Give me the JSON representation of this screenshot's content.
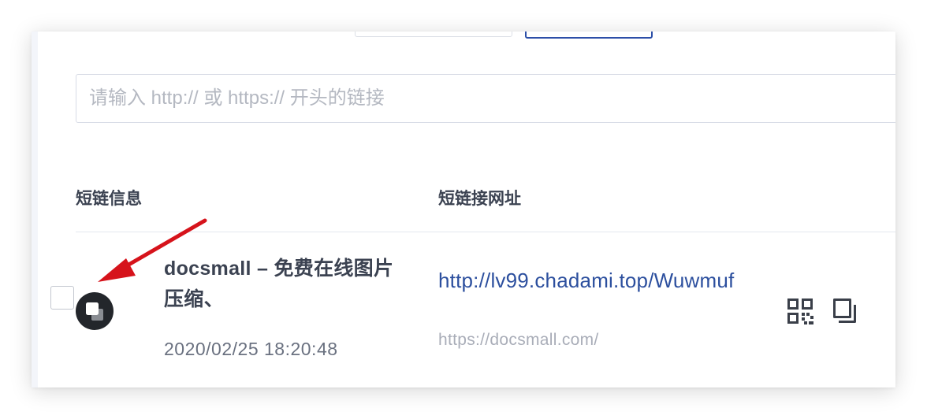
{
  "toolbar": {
    "buttons": [
      {
        "icon": "outline-button",
        "label": ""
      },
      {
        "icon": "primary-outline-button",
        "label": ""
      }
    ]
  },
  "search": {
    "placeholder": "请输入 http:// 或 https:// 开头的链接",
    "value": ""
  },
  "table": {
    "headers": [
      "短链信息",
      "短链接网址"
    ],
    "rows": [
      {
        "title": "docsmall – 免费在线图片压缩、",
        "created": "2020/02/25 18:20:48",
        "short_url": "http://lv99.chadami.top/Wuwmuf",
        "original_url": "https://docsmall.com/",
        "actions": [
          "qr-code-icon",
          "copy-icon"
        ]
      }
    ]
  },
  "annotation": {
    "type": "red-arrow",
    "color": "#d6131b",
    "points_to": "copy-badge"
  },
  "colors": {
    "link": "#2c4f9e",
    "heading": "#3b4251",
    "muted": "#a9adb8",
    "badge": "#23262b"
  }
}
